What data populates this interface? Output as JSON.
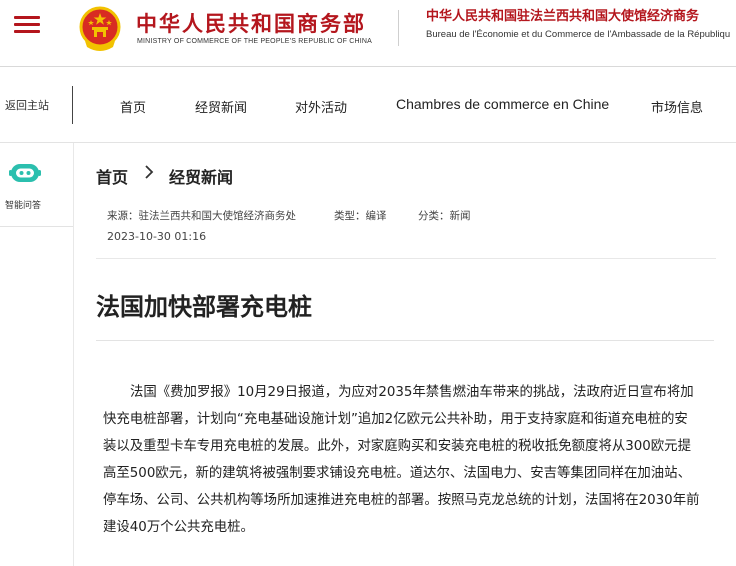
{
  "header": {
    "ministry_cn": "中华人民共和国商务部",
    "ministry_en": "MINISTRY OF COMMERCE OF THE PEOPLE'S REPUBLIC OF CHINA",
    "embassy_cn": "中华人民共和国驻法兰西共和国大使馆经济商务",
    "embassy_fr": "Bureau de l'Économie et du Commerce de l'Ambassade de la Républiqu"
  },
  "nav": {
    "back_home": "返回主站",
    "items": [
      "首页",
      "经贸新闻",
      "对外活动",
      "Chambres de commerce en Chine",
      "市场信息"
    ]
  },
  "sidebar": {
    "bot_label": "智能问答"
  },
  "breadcrumb": {
    "home": "首页",
    "current": "经贸新闻"
  },
  "article": {
    "source": "来源：驻法兰西共和国大使馆经济商务处",
    "type": "类型：编译",
    "category": "分类：新闻",
    "datetime": "2023-10-30 01:16",
    "title": "法国加快部署充电桩",
    "body_lines": [
      "法国《费加罗报》10月29日报道，为应对2035年禁售燃油车带来的挑战，法政府近日宣布将加",
      "快充电桩部署，计划向“充电基础设施计划”追加2亿欧元公共补助，用于支持家庭和街道充电桩的安",
      "装以及重型卡车专用充电桩的发展。此外，对家庭购买和安装充电桩的税收抵免额度将从300欧元提",
      "高至500欧元，新的建筑将被强制要求铺设充电桩。道达尔、法国电力、安吉等集团同样在加油站、",
      "停车场、公司、公共机构等场所加速推进充电桩的部署。按照马克龙总统的计划，法国将在2030年前",
      "建设40万个公共充电桩。"
    ]
  },
  "colors": {
    "brand_red": "#b4161d",
    "bot_teal": "#2bbfae"
  }
}
